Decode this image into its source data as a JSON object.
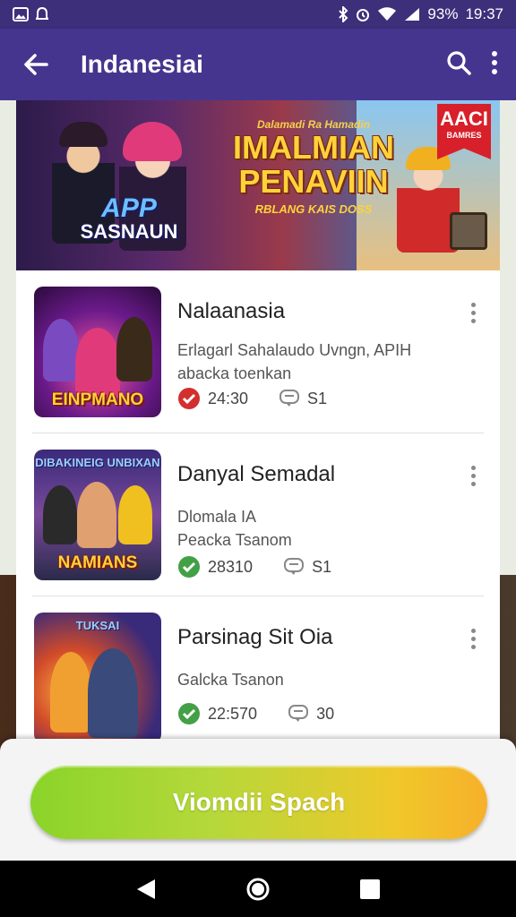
{
  "status_bar": {
    "left_icons": [
      "image-icon",
      "notification-icon"
    ],
    "battery": "93%",
    "time": "19:37"
  },
  "app_bar": {
    "title": "Indanesiai"
  },
  "banner": {
    "top_badge": "",
    "app_logo_line1": "APP",
    "app_logo_line2": "SASNAUN",
    "promo_small": "Dalamadi Ra Hamadin",
    "promo_line1": "IMALMIAN",
    "promo_line2": "PENAVIIN",
    "promo_sub": "RBLANG KAIS DOSS",
    "corner_badge_1": "AACI",
    "corner_badge_2": "BAMRES"
  },
  "apps": [
    {
      "thumb_top": "",
      "thumb_bottom": "EINPMANO",
      "title": "Nalaanasia",
      "desc": [
        "Erlagarl Sahalaudo Uvngn, APIH",
        "abacka toenkan"
      ],
      "rating": "24:30",
      "comments": "S1",
      "rating_color": "#d32f2f"
    },
    {
      "thumb_top": "DIBAKINEIG UNBIXAN",
      "thumb_bottom": "NAMIANS",
      "title": "Danyal Semadal",
      "desc": [
        "Dlomala IA",
        "Peacka Tsanom"
      ],
      "rating": "28310",
      "comments": "S1",
      "rating_color": "#43a047"
    },
    {
      "thumb_top": "TUKSAI",
      "thumb_bottom": "",
      "title": "Parsinag Sit Oia",
      "desc": [
        "Galcka Tsanon"
      ],
      "rating": "22:570",
      "comments": "30",
      "rating_color": "#43a047"
    }
  ],
  "cta": {
    "label": "Viomdii Spach"
  }
}
